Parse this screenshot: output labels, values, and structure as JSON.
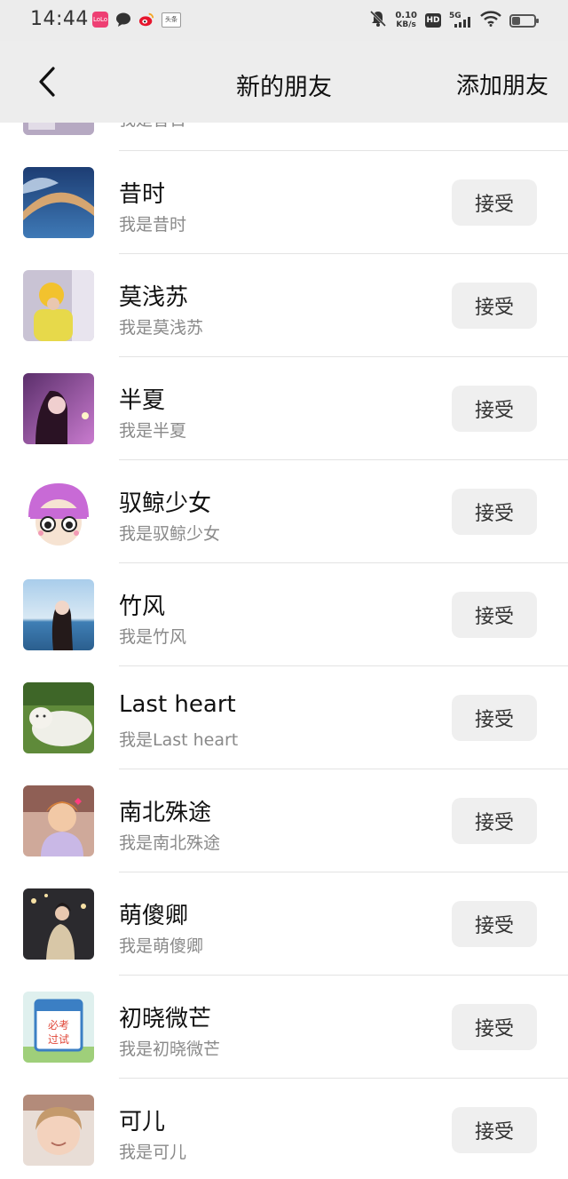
{
  "status_bar": {
    "time": "14:44",
    "app_icons": [
      "lolo-app-icon",
      "chat-bubble-icon",
      "weibo-icon",
      "toutiao-icon"
    ],
    "lolo_label": "LoLo",
    "toutiao_label": "头条",
    "net_speed_value": "0.10",
    "net_speed_unit": "KB/s",
    "hd_label": "HD",
    "network_label": "5G"
  },
  "nav": {
    "title": "新的朋友",
    "add_friend_label": "添加朋友"
  },
  "partial_row": {
    "message": "我是昔日"
  },
  "requests": [
    {
      "name": "昔时",
      "message": "我是昔时",
      "accept": "接受"
    },
    {
      "name": "莫浅苏",
      "message": "我是莫浅苏",
      "accept": "接受"
    },
    {
      "name": "半夏",
      "message": "我是半夏",
      "accept": "接受"
    },
    {
      "name": "驭鲸少女",
      "message": "我是驭鲸少女",
      "accept": "接受"
    },
    {
      "name": "竹风",
      "message": "我是竹风",
      "accept": "接受"
    },
    {
      "name": "Last heart",
      "message": "我是Last heart",
      "accept": "接受"
    },
    {
      "name": "南北殊途",
      "message": "我是南北殊途",
      "accept": "接受"
    },
    {
      "name": "萌傻卿",
      "message": "我是萌傻卿",
      "accept": "接受"
    },
    {
      "name": "初晓微芒",
      "message": "我是初晓微芒",
      "accept": "接受"
    },
    {
      "name": "可儿",
      "message": "我是可儿",
      "accept": "接受"
    }
  ],
  "colors": {
    "nav_background": "#ededed",
    "accept_button_bg": "#efefef",
    "secondary_text": "#8a8a8a"
  }
}
